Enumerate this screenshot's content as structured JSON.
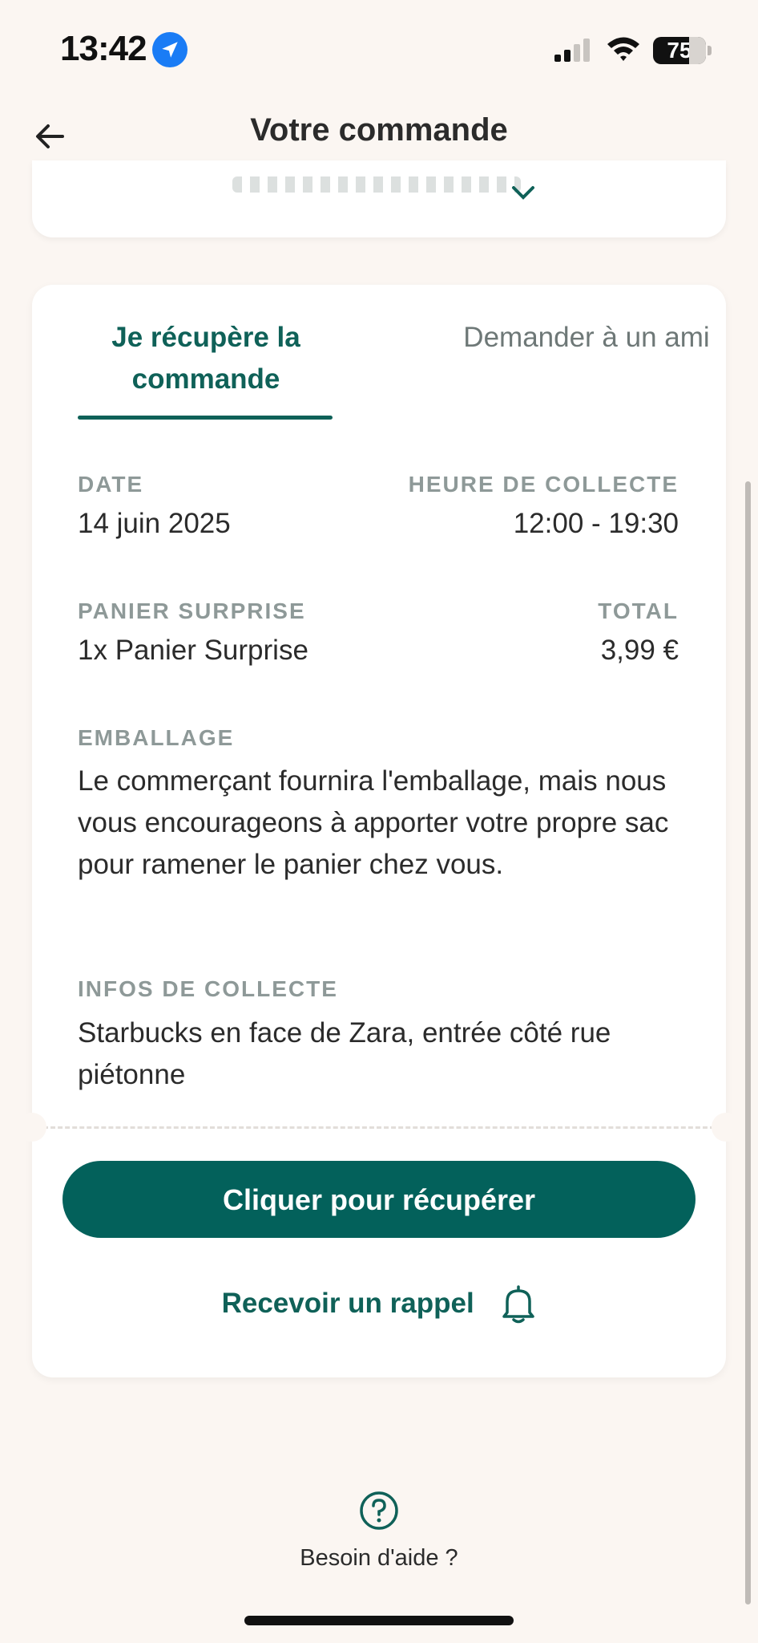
{
  "status_bar": {
    "time": "13:42",
    "battery": "75"
  },
  "header": {
    "title": "Votre commande"
  },
  "tabs": [
    {
      "label": "Je récupère la commande",
      "active": true
    },
    {
      "label": "Demander à un ami",
      "active": false
    }
  ],
  "order": {
    "date_label": "DATE",
    "date_value": "14 juin 2025",
    "pickup_label": "HEURE DE COLLECTE",
    "pickup_value": "12:00 - 19:30",
    "bag_label": "PANIER SURPRISE",
    "bag_value": "1x Panier Surprise",
    "total_label": "TOTAL",
    "total_value": "3,99 €",
    "packaging_label": "EMBALLAGE",
    "packaging_text": "Le commerçant fournira l'emballage, mais nous vous encourageons à apporter votre propre sac pour ramener le panier chez vous.",
    "pickup_info_label": "INFOS DE COLLECTE",
    "pickup_info_text": "Starbucks en face de Zara, entrée côté rue piétonne"
  },
  "actions": {
    "primary_label": "Cliquer pour récupérer",
    "reminder_label": "Recevoir un rappel"
  },
  "help": {
    "label": "Besoin d'aide ?"
  },
  "colors": {
    "accent": "#03615B",
    "background": "#FBF6F2",
    "label_grey": "#8E9998"
  },
  "icons": [
    "location-arrow-icon",
    "signal-icon",
    "wifi-icon",
    "battery-icon",
    "back-arrow-icon",
    "chevron-down-icon",
    "bell-icon",
    "question-circle-icon"
  ]
}
